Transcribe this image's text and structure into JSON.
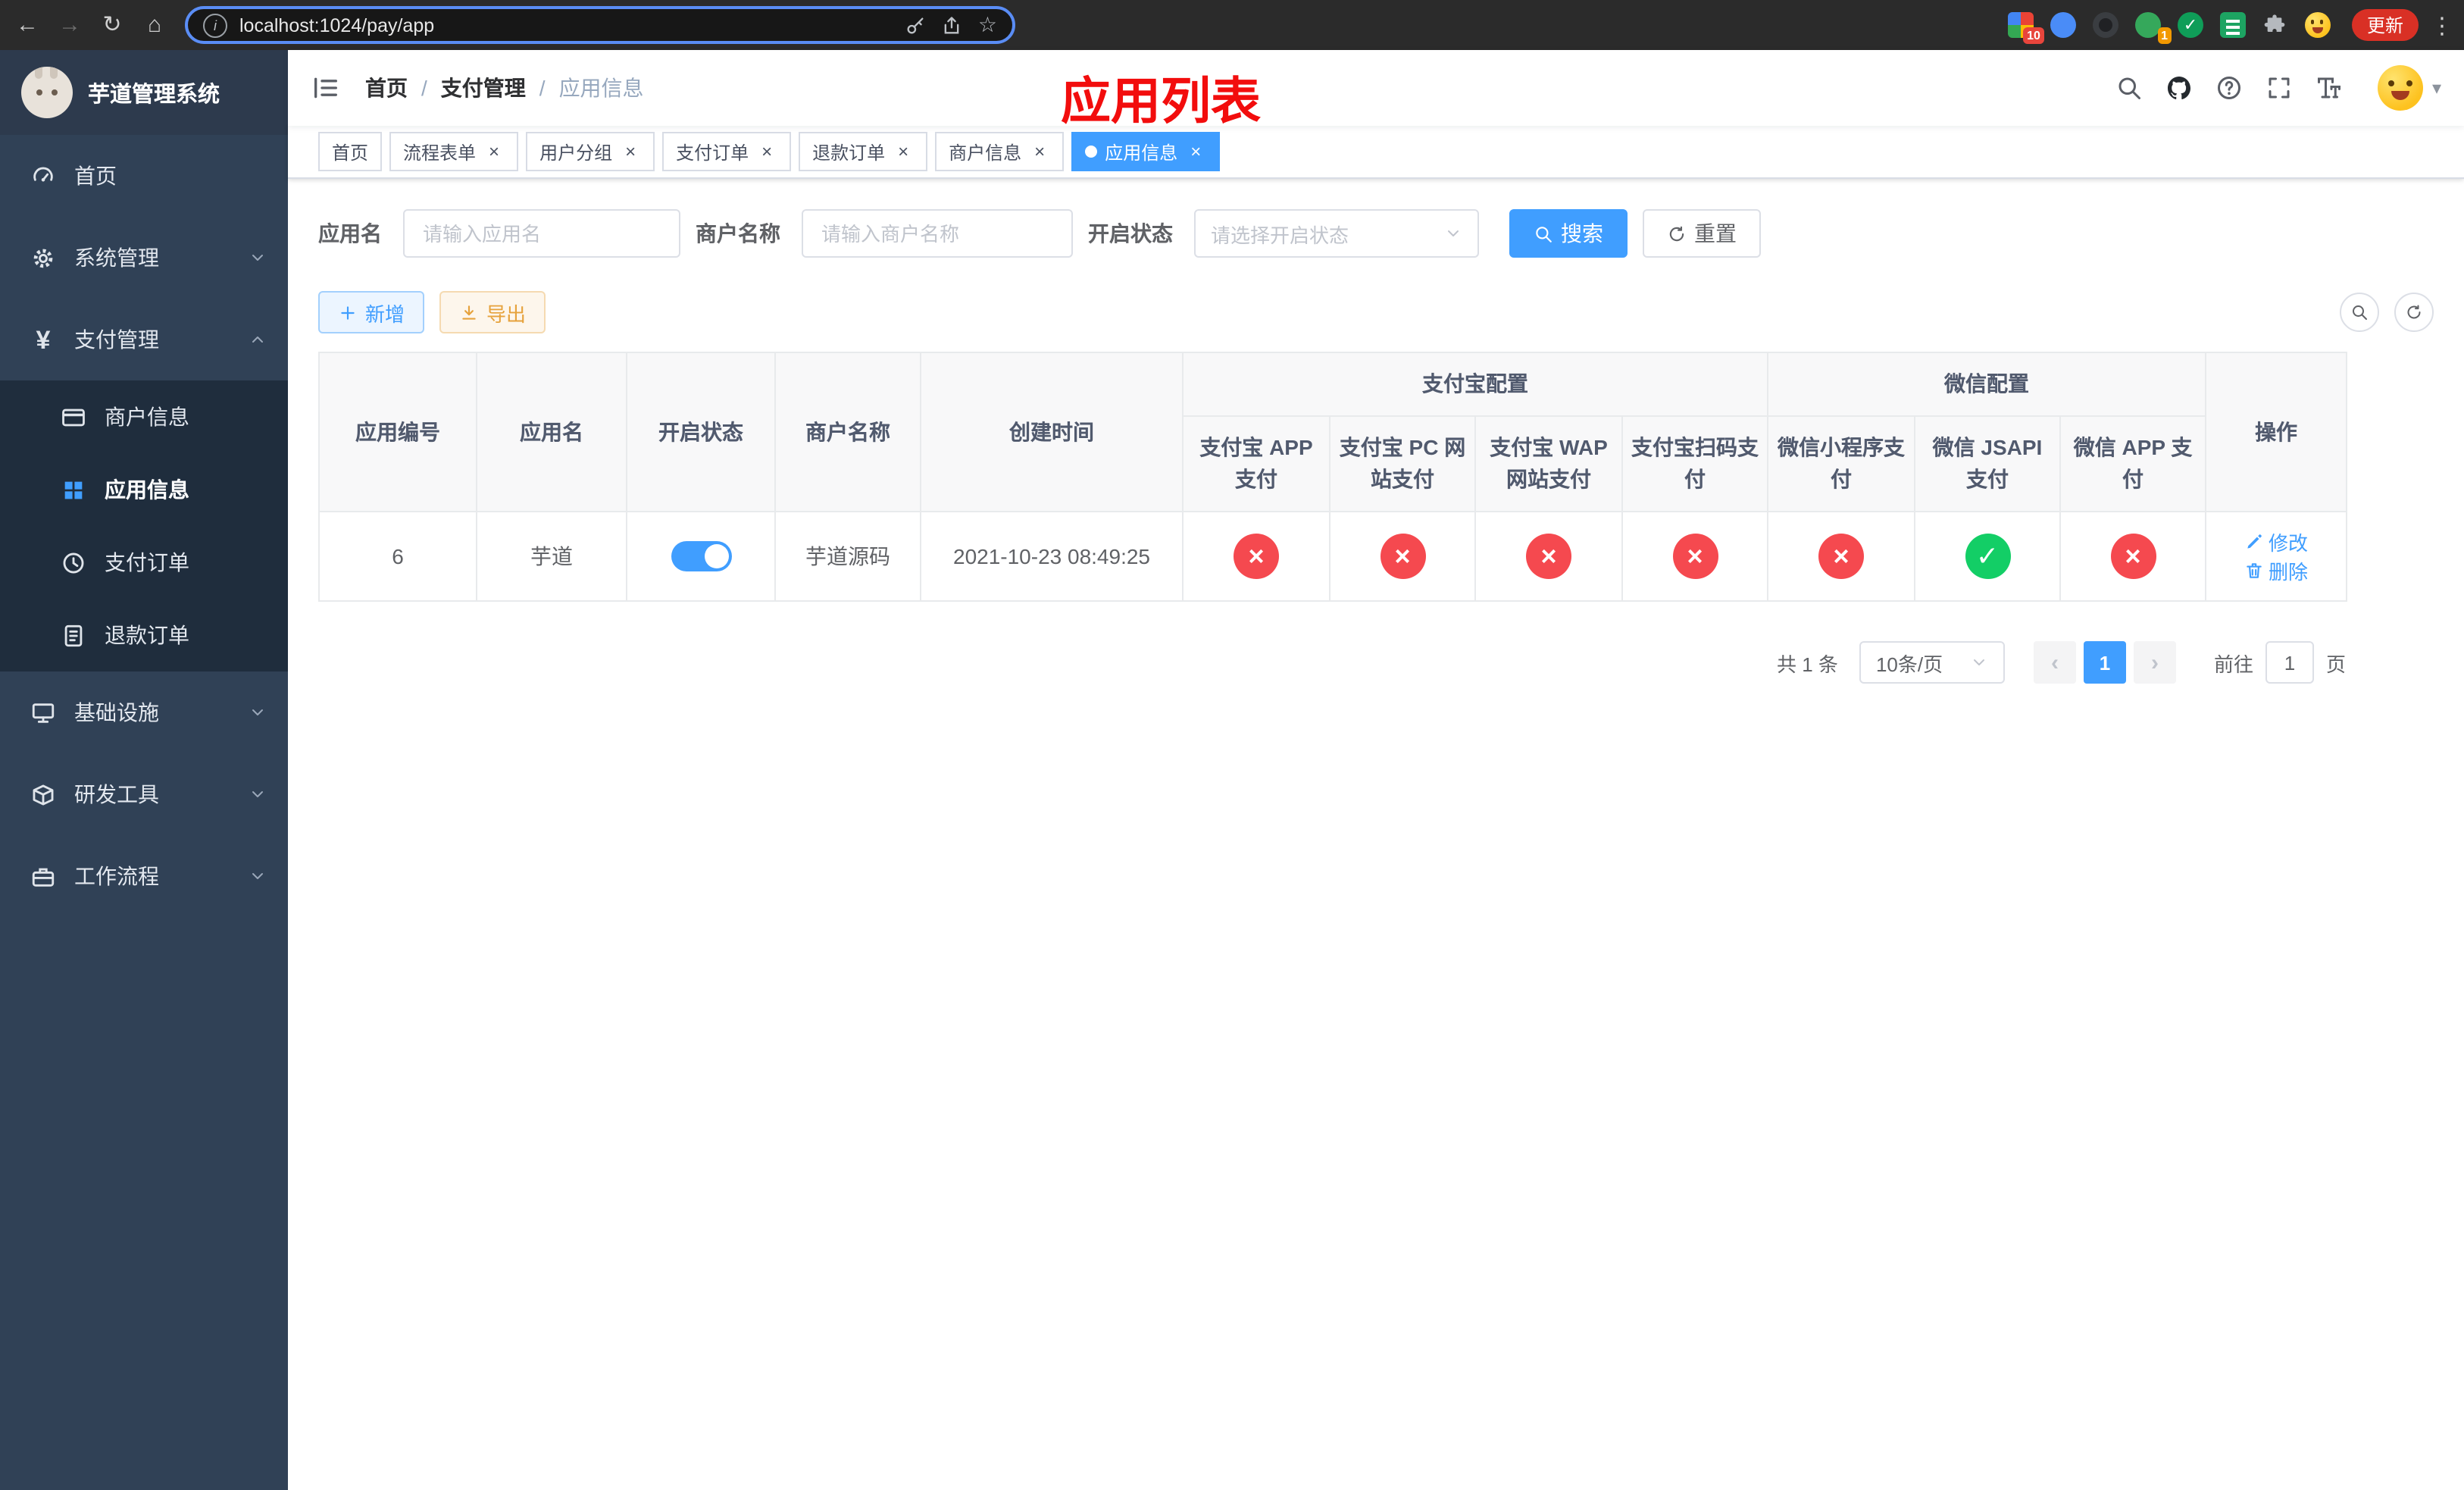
{
  "colors": {
    "accent": "#409eff",
    "warning": "#e6a23c",
    "status_ok": "#13ce66",
    "status_fail": "#f5494f",
    "overlay_title_red": "#f20d0d",
    "update_button_red": "#d93025",
    "sidebar_bg": "#304156",
    "submenu_bg": "#1f2d3d"
  },
  "icons": {
    "back": "←",
    "forward": "→",
    "reload": "↻",
    "home": "⌂",
    "info": "i",
    "star": "☆",
    "dots": "⋮",
    "caret": "▾",
    "check": "✓",
    "cross": "×",
    "prev": "‹",
    "next": "›",
    "yen": "¥",
    "breadcrumb_sep": "/"
  },
  "browser": {
    "url": "localhost:1024/pay/app",
    "update_button": "更新",
    "extension_badges": {
      "grid": "10",
      "avatar": "1"
    }
  },
  "sidebar": {
    "title": "芋道管理系统",
    "menu": [
      {
        "label": "首页"
      },
      {
        "label": "系统管理"
      },
      {
        "label": "支付管理"
      },
      {
        "label": "商户信息"
      },
      {
        "label": "应用信息"
      },
      {
        "label": "支付订单"
      },
      {
        "label": "退款订单"
      },
      {
        "label": "基础设施"
      },
      {
        "label": "研发工具"
      },
      {
        "label": "工作流程"
      }
    ]
  },
  "header": {
    "breadcrumb": [
      "首页",
      "支付管理",
      "应用信息"
    ],
    "overlay_title": "应用列表"
  },
  "tabs": [
    {
      "label": "首页"
    },
    {
      "label": "流程表单"
    },
    {
      "label": "用户分组"
    },
    {
      "label": "支付订单"
    },
    {
      "label": "退款订单"
    },
    {
      "label": "商户信息"
    },
    {
      "label": "应用信息"
    }
  ],
  "filters": {
    "app_name": {
      "label": "应用名",
      "placeholder": "请输入应用名"
    },
    "merchant_name": {
      "label": "商户名称",
      "placeholder": "请输入商户名称"
    },
    "status": {
      "label": "开启状态",
      "placeholder": "请选择开启状态"
    },
    "search_button": "搜索",
    "reset_button": "重置"
  },
  "toolbar": {
    "add_button": "新增",
    "export_button": "导出"
  },
  "table": {
    "group_headers": {
      "alipay": "支付宝配置",
      "wechat": "微信配置"
    },
    "columns": [
      "应用编号",
      "应用名",
      "开启状态",
      "商户名称",
      "创建时间",
      "支付宝 APP 支付",
      "支付宝 PC 网站支付",
      "支付宝 WAP 网站支付",
      "支付宝扫码支付",
      "微信小程序支付",
      "微信 JSAPI 支付",
      "微信 APP 支付",
      "操作"
    ],
    "rows": [
      {
        "id": "6",
        "name": "芋道",
        "status_on": true,
        "merchant": "芋道源码",
        "created": "2021-10-23 08:49:25",
        "channels": [
          "no",
          "no",
          "no",
          "no",
          "no",
          "yes",
          "no"
        ],
        "edit": "修改",
        "delete": "删除"
      }
    ]
  },
  "pagination": {
    "total": "共 1 条",
    "page_size": "10条/页",
    "page": "1",
    "goto_label": "前往",
    "goto_value": "1",
    "goto_suffix": "页"
  }
}
